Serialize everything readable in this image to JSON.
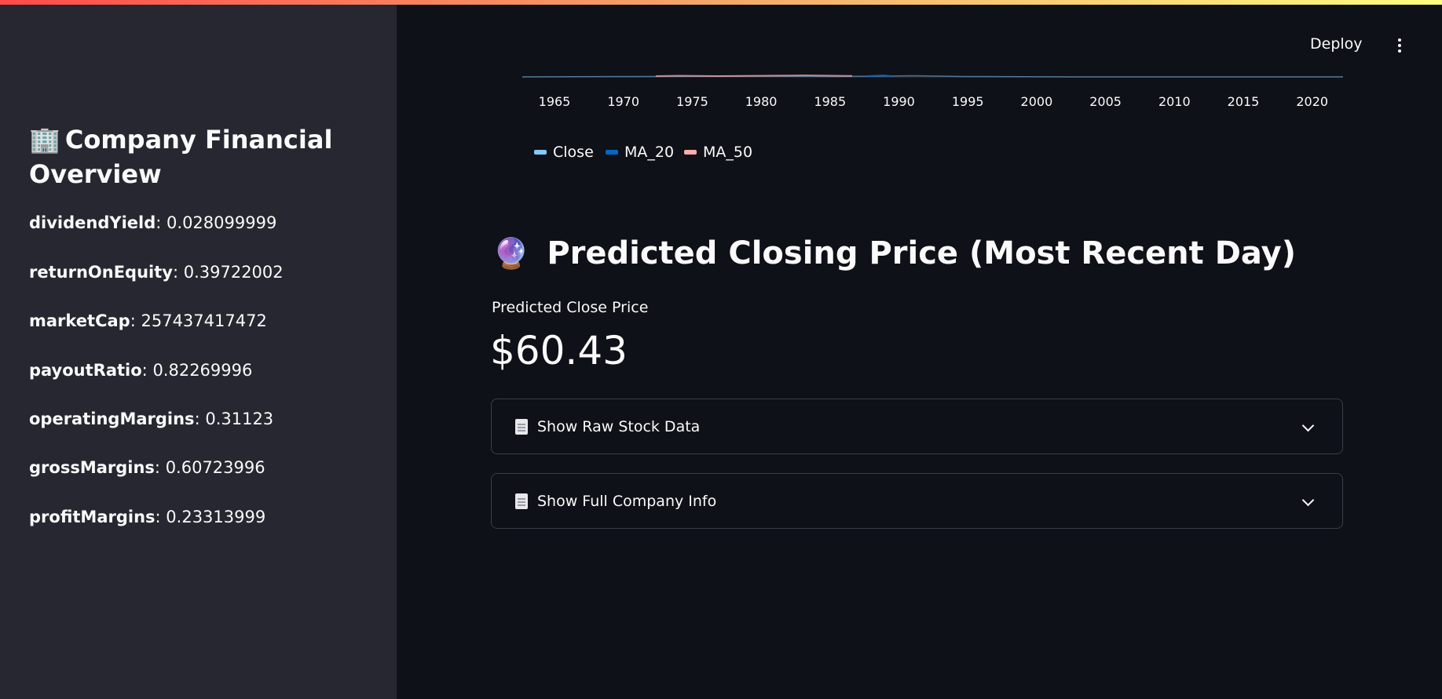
{
  "sidebar": {
    "title_emoji": "🏢",
    "title": "Company Financial Overview",
    "metrics": [
      {
        "key": "dividendYield",
        "sep": ": ",
        "value": "0.028099999"
      },
      {
        "key": "returnOnEquity",
        "sep": ": ",
        "value": "0.39722002"
      },
      {
        "key": "marketCap",
        "sep": ": ",
        "value": "257437417472"
      },
      {
        "key": "payoutRatio",
        "sep": ": ",
        "value": "0.82269996"
      },
      {
        "key": "operatingMargins",
        "sep": ": ",
        "value": "0.31123"
      },
      {
        "key": "grossMargins",
        "sep": ": ",
        "value": "0.60723996"
      },
      {
        "key": "profitMargins",
        "sep": ": ",
        "value": "0.23313999"
      }
    ]
  },
  "header": {
    "deploy_label": "Deploy",
    "menu_icon": "kebab-menu-icon"
  },
  "chart_data": {
    "type": "line",
    "x_ticks": [
      "1965",
      "1970",
      "1975",
      "1980",
      "1985",
      "1990",
      "1995",
      "2000",
      "2005",
      "2010",
      "2015",
      "2020"
    ],
    "series": [
      {
        "name": "Close",
        "color": "#83c9ff"
      },
      {
        "name": "MA_20",
        "color": "#0068c9"
      },
      {
        "name": "MA_50",
        "color": "#ffabab"
      }
    ],
    "legend_position": "bottom-left"
  },
  "prediction": {
    "emoji": "🔮",
    "heading": "Predicted Closing Price (Most Recent Day)",
    "label": "Predicted Close Price",
    "value": "$60.43"
  },
  "expanders": [
    {
      "icon": "document-icon",
      "label": "Show Raw Stock Data"
    },
    {
      "icon": "document-icon",
      "label": "Show Full Company Info"
    }
  ],
  "colors": {
    "sidebar_bg": "#262730",
    "main_bg": "#0e1117",
    "text": "#fafafa"
  }
}
